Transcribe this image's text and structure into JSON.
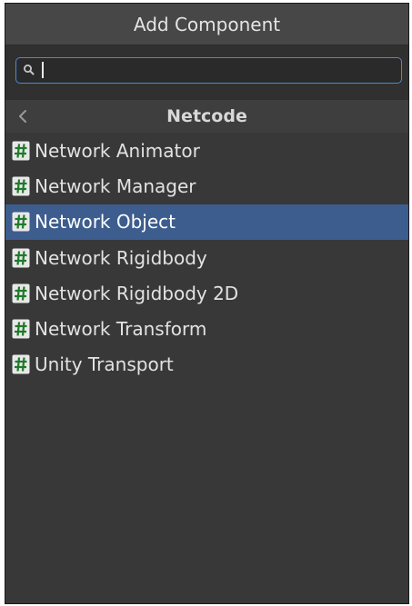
{
  "window": {
    "title": "Add Component"
  },
  "search": {
    "value": "",
    "placeholder": ""
  },
  "category": {
    "title": "Netcode"
  },
  "items": [
    {
      "label": "Network Animator",
      "icon": "script-icon",
      "selected": false
    },
    {
      "label": "Network Manager",
      "icon": "script-icon",
      "selected": false
    },
    {
      "label": "Network Object",
      "icon": "script-icon",
      "selected": true
    },
    {
      "label": "Network Rigidbody",
      "icon": "script-icon",
      "selected": false
    },
    {
      "label": "Network Rigidbody 2D",
      "icon": "script-icon",
      "selected": false
    },
    {
      "label": "Network Transform",
      "icon": "script-icon",
      "selected": false
    },
    {
      "label": "Unity Transport",
      "icon": "script-icon",
      "selected": false
    }
  ],
  "colors": {
    "panel_bg": "#383838",
    "title_bg": "#474747",
    "selected_bg": "#3d5d8e",
    "search_border": "#4a8ad4",
    "script_icon_bg": "#e8e8e8",
    "script_icon_hash": "#1f7a2a"
  }
}
